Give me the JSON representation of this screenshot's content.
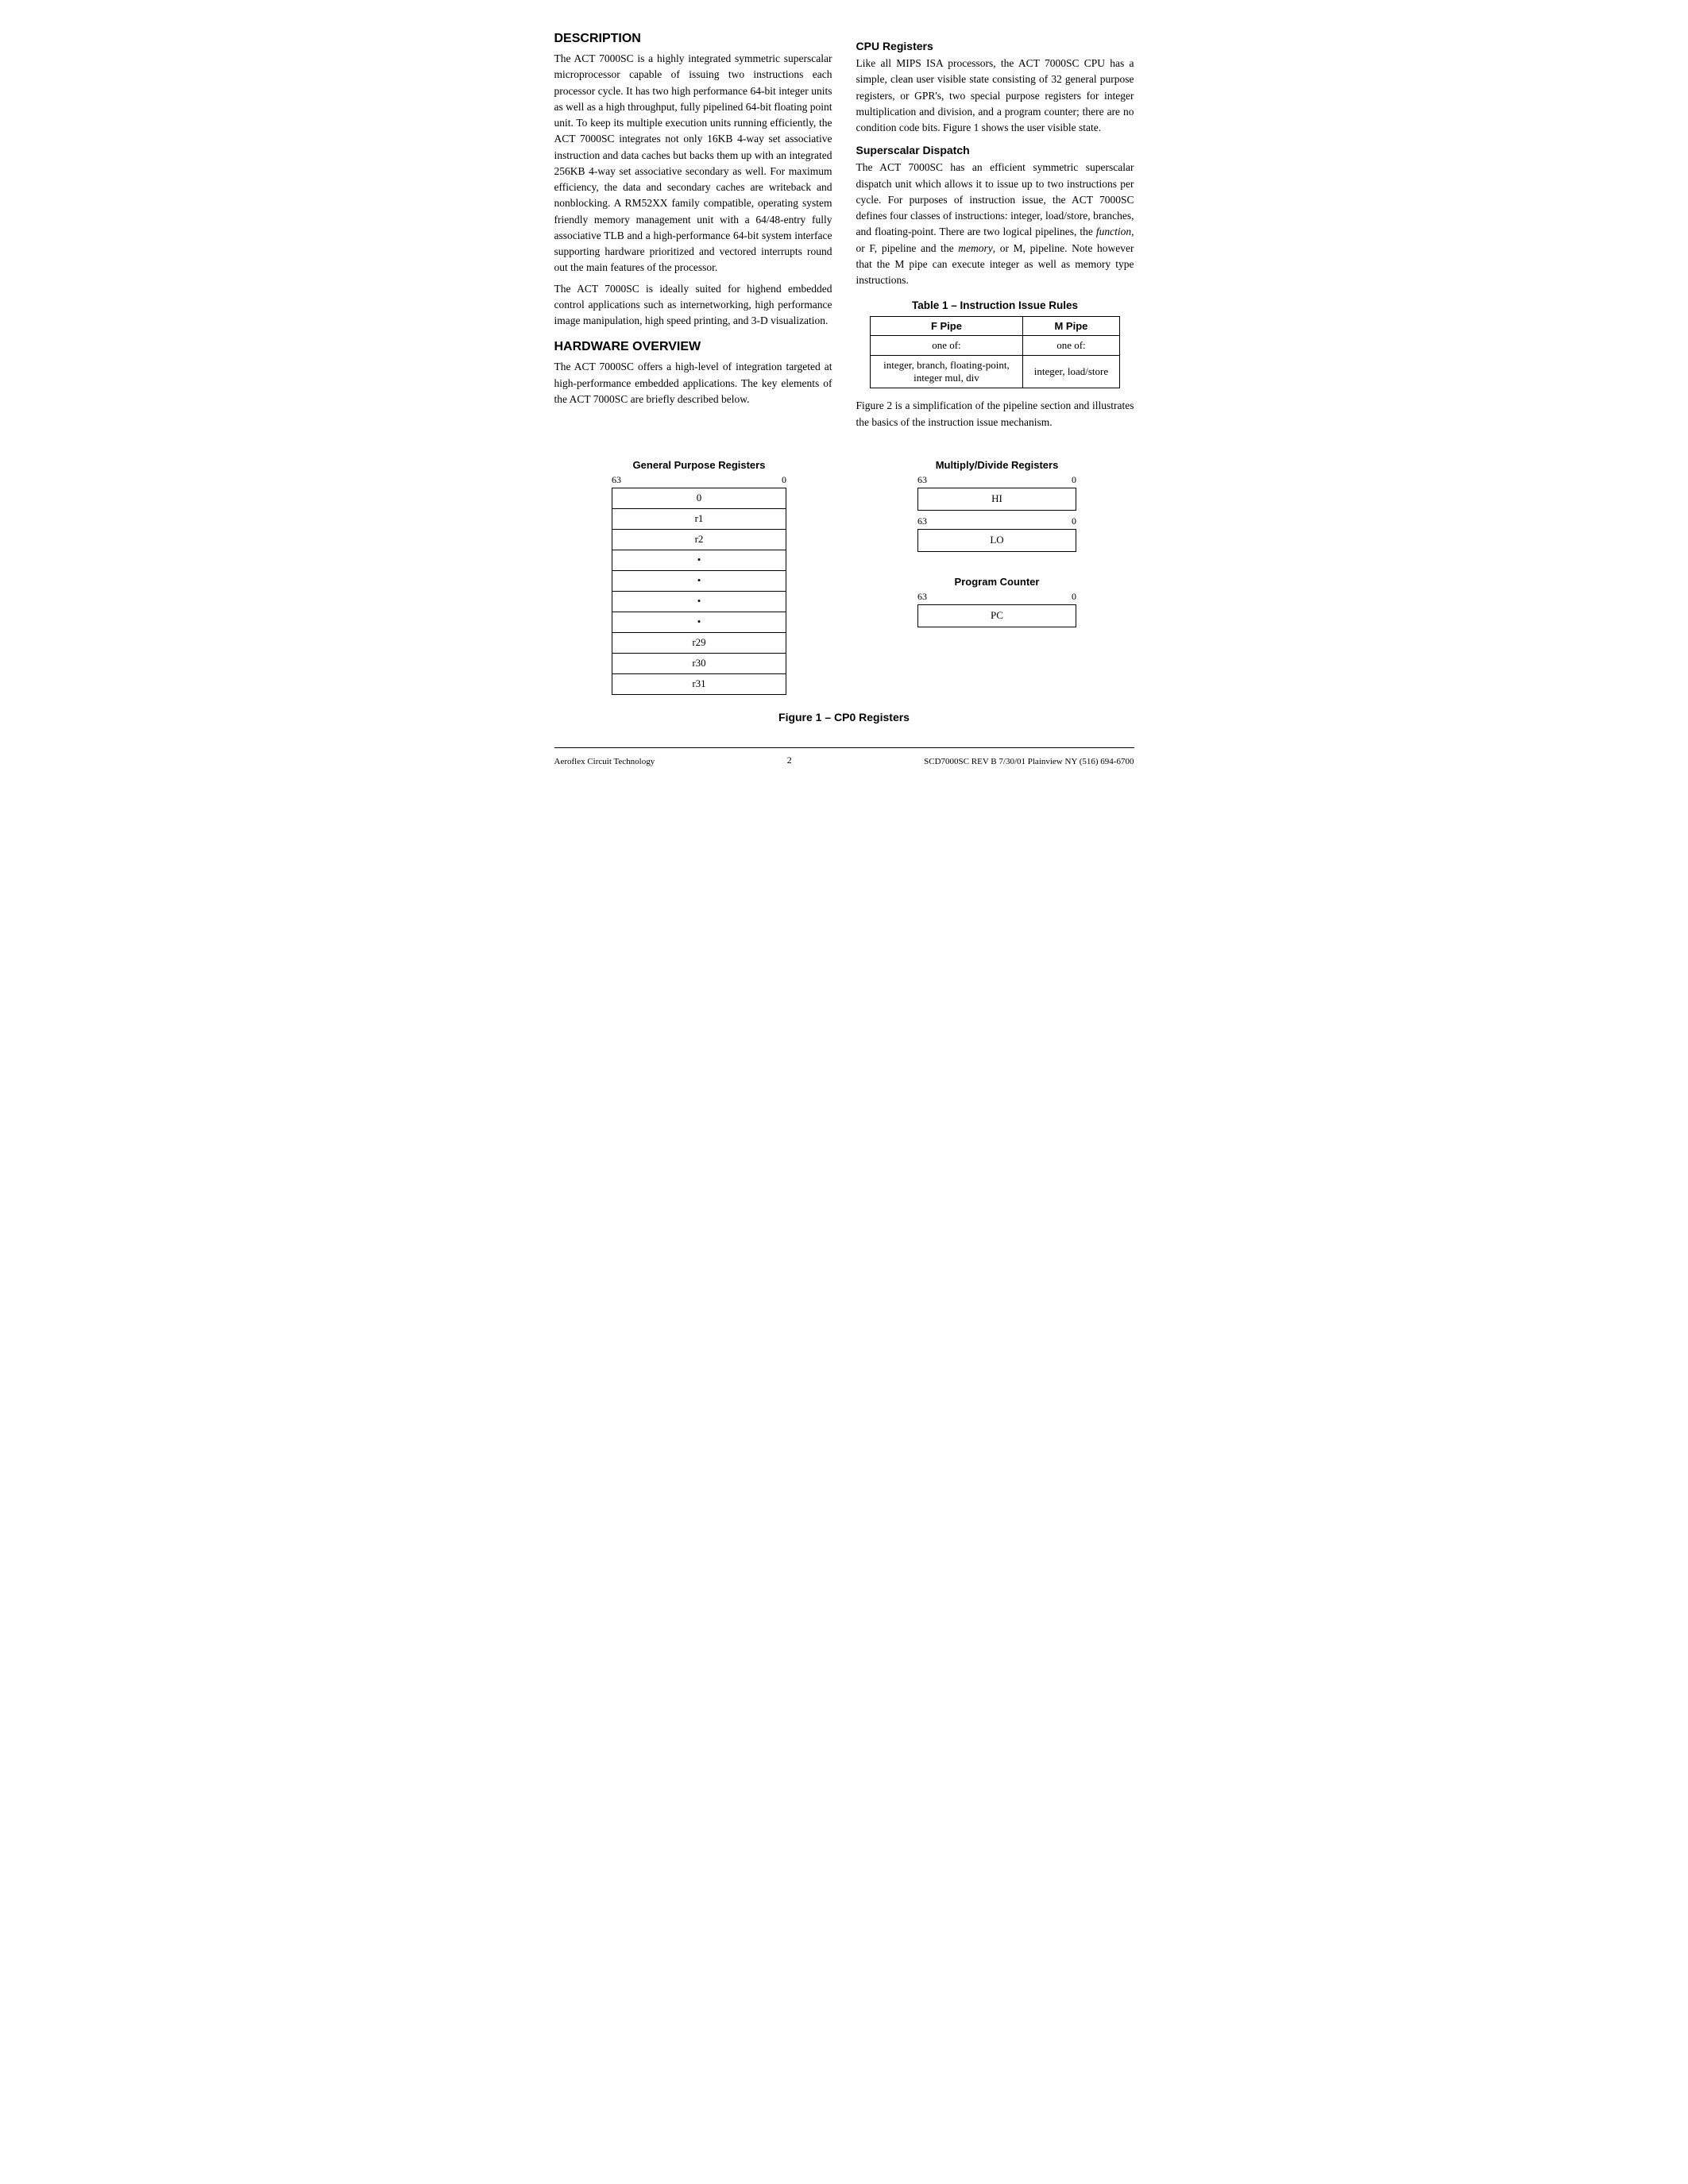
{
  "page": {
    "sections": {
      "description": {
        "title": "DESCRIPTION",
        "paragraphs": [
          "The ACT 7000SC is a highly integrated symmetric superscalar microprocessor capable of issuing two instructions each processor cycle. It has two high performance 64-bit integer units as well as a high throughput, fully pipelined 64-bit floating point unit. To keep its multiple execution units running efficiently, the ACT 7000SC integrates not only 16KB 4-way set associative instruction and data caches but backs them up with an integrated 256KB 4-way set associative secondary as well. For maximum efficiency, the data and secondary caches are writeback and nonblocking. A RM52XX family compatible, operating system friendly memory management unit with a 64/48-entry fully associative TLB and a high-performance 64-bit system interface supporting hardware prioritized and vectored interrupts round out the main features of the processor.",
          "The ACT 7000SC is ideally suited for highend embedded control applications such as internetworking, high performance image manipulation, high speed printing, and 3-D visualization."
        ]
      },
      "hardware_overview": {
        "title": "HARDWARE OVERVIEW",
        "paragraphs": [
          "The ACT 7000SC offers a high-level of integration targeted at high-performance embedded applications. The key elements of the ACT 7000SC are briefly described below."
        ]
      },
      "cpu_registers": {
        "title": "CPU Registers",
        "paragraphs": [
          "Like all MIPS ISA processors, the ACT 7000SC CPU has a simple, clean user visible state consisting of 32 general purpose registers, or GPR's, two special purpose registers for integer multiplication and division, and a program counter; there are no condition code bits. Figure 1 shows the user visible state."
        ]
      },
      "superscalar_dispatch": {
        "title": "Superscalar Dispatch",
        "paragraphs": [
          "The ACT 7000SC has an efficient symmetric superscalar dispatch unit which allows it to issue up to two instructions per cycle. For purposes of instruction issue, the ACT 7000SC defines four classes of instructions: integer, load/store, branches, and floating-point. There are two logical pipelines, the function, or F, pipeline and the memory, or M, pipeline. Note however that the M pipe can execute integer as well as memory type instructions."
        ]
      },
      "table": {
        "title": "Table 1 – Instruction Issue Rules",
        "headers": [
          "F Pipe",
          "M Pipe"
        ],
        "rows": [
          [
            "one of:",
            "one of:"
          ],
          [
            "integer, branch, floating-point,\ninteger mul, div",
            "integer, load/store"
          ]
        ]
      },
      "pipeline_note": {
        "paragraphs": [
          "Figure 2 is a simplification of the pipeline section and illustrates the basics of the instruction issue mechanism."
        ]
      }
    },
    "figure": {
      "gpr": {
        "title": "General Purpose Registers",
        "label_left": "63",
        "label_right": "0",
        "rows": [
          "0",
          "r1",
          "r2",
          "•",
          "•",
          "•",
          "•",
          "r29",
          "r30",
          "r31"
        ]
      },
      "multiply_divide": {
        "title": "Multiply/Divide Registers",
        "label_left": "63",
        "label_right": "0",
        "rows_hi": [
          "HI"
        ],
        "label_left2": "63",
        "label_right2": "0",
        "rows_lo": [
          "LO"
        ]
      },
      "program_counter": {
        "title": "Program Counter",
        "label_left": "63",
        "label_right": "0",
        "rows": [
          "PC"
        ]
      },
      "caption": "Figure 1 – CP0 Registers"
    },
    "footer": {
      "left": "Aeroflex Circuit Technology",
      "center": "2",
      "right": "SCD7000SC REV B  7/30/01  Plainview NY (516) 694-6700"
    }
  }
}
